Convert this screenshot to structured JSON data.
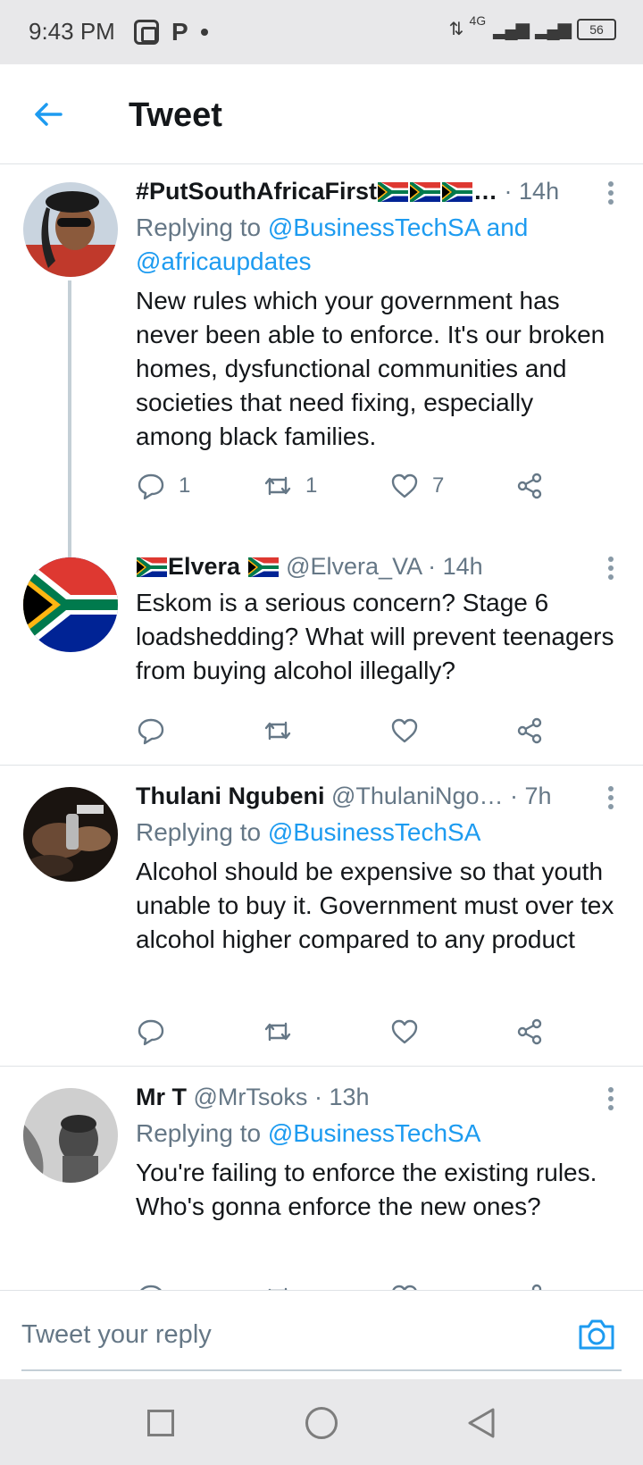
{
  "status_bar": {
    "time": "9:43 PM",
    "network": "4G",
    "battery": "56"
  },
  "header": {
    "title": "Tweet"
  },
  "tweets": [
    {
      "name": "#PutSouthAfricaFirst",
      "name_suffix": "…",
      "handle": "",
      "time": "· 14h",
      "replying_prefix": "Replying to",
      "mentions": "@BusinessTechSA and @africaupdates",
      "text": "New rules which your government has never been able to enforce. It's our broken homes, dysfunctional communities and societies that need fixing, especially among black families.",
      "replies": "1",
      "retweets": "1",
      "likes": "7"
    },
    {
      "name": "Elvera",
      "handle": "@Elvera_VA",
      "time": "· 14h",
      "text": "Eskom is a serious concern? Stage 6 loadshedding? What will prevent teenagers from buying alcohol illegally?"
    },
    {
      "name": "Thulani Ngubeni",
      "handle": "@ThulaniNgo…",
      "time": "· 7h",
      "replying_prefix": "Replying to",
      "mentions": "@BusinessTechSA",
      "text": "Alcohol should be expensive so that youth unable to buy it. Government must over tex alcohol higher compared to any product"
    },
    {
      "name": "Mr T",
      "handle": "@MrTsoks",
      "time": "· 13h",
      "replying_prefix": "Replying to",
      "mentions": "@BusinessTechSA",
      "text": "You're failing to enforce the existing rules. Who's gonna enforce the new ones?"
    }
  ],
  "reply_bar": {
    "placeholder": "Tweet your reply"
  },
  "icons": {
    "back": "arrow-left-icon",
    "more": "vertical-dots-icon",
    "reply": "speech-bubble-icon",
    "retweet": "retweet-icon",
    "like": "heart-icon",
    "share": "share-icon",
    "camera": "camera-icon"
  },
  "colors": {
    "accent": "#1d9bf0",
    "secondary_text": "#657786",
    "primary_text": "#14171a"
  }
}
